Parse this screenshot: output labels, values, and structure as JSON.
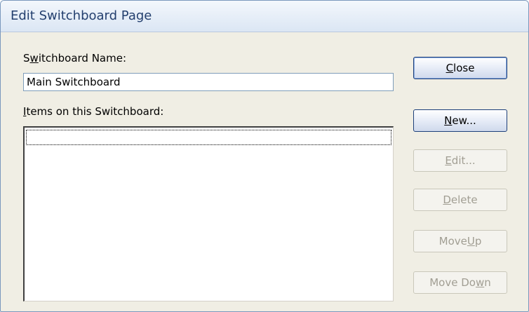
{
  "dialog": {
    "title": "Edit Switchboard Page",
    "switchboard_name_label_pre": "S",
    "switchboard_name_label_key": "w",
    "switchboard_name_label_post": "itchboard Name:",
    "switchboard_name_value": "Main Switchboard",
    "items_label_key": "I",
    "items_label_post": "tems on this Switchboard:",
    "items": []
  },
  "buttons": {
    "close": {
      "key": "C",
      "post": "lose",
      "enabled": true
    },
    "new": {
      "key": "N",
      "post": "ew...",
      "enabled": true
    },
    "edit": {
      "key": "E",
      "post": "dit...",
      "enabled": false
    },
    "delete": {
      "key": "D",
      "post": "elete",
      "enabled": false
    },
    "move_up": {
      "pre": "Move ",
      "key": "U",
      "post": "p",
      "enabled": false
    },
    "move_down": {
      "pre": "Move Do",
      "key": "w",
      "post": "n",
      "enabled": false
    }
  },
  "colors": {
    "title_text": "#233f6e",
    "dialog_background": "#f0eee4",
    "disabled_text": "#a19e93"
  }
}
